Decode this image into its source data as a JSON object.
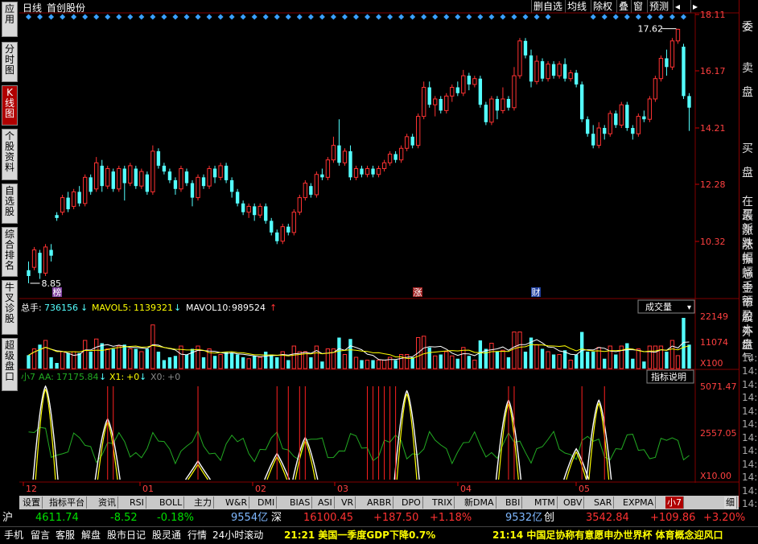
{
  "header": {
    "period": "日线",
    "stock_name": "首创股份",
    "buttons": [
      "删自选",
      "均线",
      "除权",
      "叠",
      "窗",
      "预测"
    ]
  },
  "left_tabs": [
    "应用",
    "分时图",
    "K线图",
    "个股资料",
    "自选股",
    "综合排名",
    "牛叉诊股",
    "超级盘口"
  ],
  "price_axis": [
    "18.11",
    "16.17",
    "14.21",
    "12.28",
    "10.32"
  ],
  "price_annotations": {
    "high": "17.62",
    "low": "8.85"
  },
  "event_markers": {
    "bang": "榜",
    "zhang": "涨",
    "cai": "财"
  },
  "volume_panel": {
    "total_label": "总手:",
    "total_value": "736156",
    "mavol5_label": "MAVOL5:",
    "mavol5_value": "1139321",
    "mavol10_label": "MAVOL10:",
    "mavol10_value": "989524",
    "dropdown": "成交量",
    "axis": [
      "22149",
      "11074",
      "X100"
    ]
  },
  "indicator_panel": {
    "name": "小7",
    "aa_label": "AA:",
    "aa_value": "17175.84",
    "x1_label": "X1:",
    "x1_value": "+0",
    "x0_label": "X0:",
    "x0_value": "+0",
    "help_button": "指标说明",
    "axis": [
      "5071.47",
      "2557.05",
      "X10.00"
    ]
  },
  "date_axis": [
    "12",
    "01",
    "02",
    "03",
    "04",
    "05"
  ],
  "right_panel": {
    "top": "委",
    "sell": "卖盘",
    "buy": "买盘",
    "labels": [
      "在买",
      "最新",
      "涨跌",
      "涨幅",
      "振幅",
      "总手",
      "金额",
      "市盈",
      "股本",
      "外盘"
    ],
    "times": [
      "燃气",
      "14:",
      "14:",
      "14:",
      "14:",
      "14:",
      "14:",
      "14:",
      "14:",
      "14:",
      "14:",
      "14:",
      "14:"
    ]
  },
  "bottom_tabs": [
    "设置",
    "指标平台",
    "资讯",
    "RSI",
    "BOLL",
    "主力",
    "W&R",
    "DMI",
    "BIAS",
    "ASI",
    "VR",
    "ARBR",
    "DPO",
    "TRIX",
    "新DMA",
    "BBI",
    "MTM",
    "OBV",
    "SAR",
    "EXPMA",
    "小7"
  ],
  "bottom_tab_extra": "细",
  "index_row": {
    "sh_label": "沪",
    "sh_value": "4611.74",
    "sh_change": "-8.52",
    "sh_pct": "-0.18%",
    "sh_amount": "9554亿",
    "sz_label": "深",
    "sz_value": "16100.45",
    "sz_change": "+187.50",
    "sz_pct": "+1.18%",
    "sz_amount": "9532亿",
    "cy_label": "创",
    "cy_value": "3542.84",
    "cy_change": "+109.86",
    "cy_pct": "+3.20%"
  },
  "footer": {
    "buttons": [
      "手机",
      "留言",
      "客服",
      "解盘",
      "股市日记",
      "股灵通",
      "行情",
      "24小时滚动"
    ],
    "news1": "21:21 美国一季度GDP下降0.7%",
    "news2": "21:14 中国足协称有意愿申办世界杯 体育概念迎风口"
  },
  "colors": {
    "up": "#ff3232",
    "down": "#54ffff",
    "diamond": "#3aa0ff",
    "grid": "#800000",
    "ma_white": "#ffffff",
    "ma_yellow": "#ffff00",
    "aa_green": "#22aa22"
  },
  "chart_data": {
    "type": "candlestick",
    "title": "",
    "date_ticks": [
      "12",
      "01",
      "02",
      "03",
      "04",
      "05"
    ],
    "ylim": [
      8.85,
      18.11
    ],
    "high_label": 17.62,
    "low_label": 8.85,
    "candles": [
      {
        "o": 9.3,
        "c": 9.1,
        "h": 9.6,
        "l": 8.85
      },
      {
        "o": 9.4,
        "c": 10.0,
        "h": 10.1,
        "l": 9.3
      },
      {
        "o": 9.9,
        "c": 9.2,
        "h": 10.0,
        "l": 9.0
      },
      {
        "o": 9.2,
        "c": 10.1,
        "h": 10.2,
        "l": 9.1
      },
      {
        "o": 10.0,
        "c": 9.8,
        "h": 10.2,
        "l": 9.6
      },
      {
        "o": 11.2,
        "c": 11.1,
        "h": 11.3,
        "l": 11.0
      },
      {
        "o": 11.3,
        "c": 11.8,
        "h": 11.9,
        "l": 11.2
      },
      {
        "o": 11.8,
        "c": 11.4,
        "h": 12.0,
        "l": 11.3
      },
      {
        "o": 11.5,
        "c": 12.0,
        "h": 12.1,
        "l": 11.4
      },
      {
        "o": 12.0,
        "c": 11.6,
        "h": 12.2,
        "l": 11.5
      },
      {
        "o": 11.6,
        "c": 12.5,
        "h": 12.6,
        "l": 11.5
      },
      {
        "o": 12.5,
        "c": 12.0,
        "h": 12.6,
        "l": 11.9
      },
      {
        "o": 12.1,
        "c": 13.0,
        "h": 13.2,
        "l": 12.0
      },
      {
        "o": 12.9,
        "c": 12.2,
        "h": 13.1,
        "l": 12.0
      },
      {
        "o": 12.2,
        "c": 12.8,
        "h": 12.9,
        "l": 12.1
      },
      {
        "o": 12.7,
        "c": 12.1,
        "h": 12.8,
        "l": 12.0
      },
      {
        "o": 12.1,
        "c": 12.8,
        "h": 12.9,
        "l": 12.0
      },
      {
        "o": 12.8,
        "c": 12.3,
        "h": 12.9,
        "l": 11.7
      },
      {
        "o": 12.3,
        "c": 12.9,
        "h": 13.0,
        "l": 12.2
      },
      {
        "o": 12.8,
        "c": 12.2,
        "h": 12.9,
        "l": 12.1
      },
      {
        "o": 12.2,
        "c": 12.7,
        "h": 12.8,
        "l": 12.1
      },
      {
        "o": 12.6,
        "c": 12.0,
        "h": 12.7,
        "l": 11.9
      },
      {
        "o": 12.0,
        "c": 13.4,
        "h": 13.6,
        "l": 11.9
      },
      {
        "o": 13.4,
        "c": 12.9,
        "h": 13.5,
        "l": 12.8
      },
      {
        "o": 12.9,
        "c": 12.7,
        "h": 13.0,
        "l": 12.6
      },
      {
        "o": 12.7,
        "c": 12.4,
        "h": 12.8,
        "l": 12.3
      },
      {
        "o": 12.4,
        "c": 12.1,
        "h": 12.5,
        "l": 11.9
      },
      {
        "o": 12.1,
        "c": 12.8,
        "h": 12.9,
        "l": 12.0
      },
      {
        "o": 12.7,
        "c": 12.3,
        "h": 12.8,
        "l": 12.2
      },
      {
        "o": 12.3,
        "c": 11.8,
        "h": 12.4,
        "l": 11.5
      },
      {
        "o": 11.8,
        "c": 12.5,
        "h": 12.6,
        "l": 11.7
      },
      {
        "o": 12.5,
        "c": 12.2,
        "h": 12.6,
        "l": 12.1
      },
      {
        "o": 12.2,
        "c": 12.8,
        "h": 12.9,
        "l": 12.1
      },
      {
        "o": 12.8,
        "c": 12.5,
        "h": 12.9,
        "l": 12.3
      },
      {
        "o": 12.5,
        "c": 12.9,
        "h": 13.0,
        "l": 12.4
      },
      {
        "o": 12.9,
        "c": 12.4,
        "h": 13.0,
        "l": 12.3
      },
      {
        "o": 12.4,
        "c": 12.0,
        "h": 12.5,
        "l": 11.8
      },
      {
        "o": 12.0,
        "c": 11.6,
        "h": 12.1,
        "l": 11.5
      },
      {
        "o": 11.6,
        "c": 11.3,
        "h": 11.7,
        "l": 11.2
      },
      {
        "o": 11.3,
        "c": 11.5,
        "h": 11.6,
        "l": 11.1
      },
      {
        "o": 11.5,
        "c": 11.2,
        "h": 11.6,
        "l": 11.0
      },
      {
        "o": 11.2,
        "c": 11.5,
        "h": 11.6,
        "l": 11.1
      },
      {
        "o": 11.5,
        "c": 11.0,
        "h": 11.6,
        "l": 10.9
      },
      {
        "o": 11.0,
        "c": 10.6,
        "h": 11.1,
        "l": 10.5
      },
      {
        "o": 10.6,
        "c": 10.3,
        "h": 10.7,
        "l": 10.2
      },
      {
        "o": 10.3,
        "c": 10.8,
        "h": 10.9,
        "l": 10.2
      },
      {
        "o": 10.8,
        "c": 10.6,
        "h": 10.9,
        "l": 10.5
      },
      {
        "o": 10.6,
        "c": 11.3,
        "h": 11.4,
        "l": 10.5
      },
      {
        "o": 11.3,
        "c": 11.8,
        "h": 11.9,
        "l": 11.2
      },
      {
        "o": 11.8,
        "c": 12.3,
        "h": 12.4,
        "l": 11.7
      },
      {
        "o": 12.2,
        "c": 11.9,
        "h": 12.3,
        "l": 11.8
      },
      {
        "o": 11.9,
        "c": 12.6,
        "h": 12.7,
        "l": 11.8
      },
      {
        "o": 12.6,
        "c": 12.5,
        "h": 12.8,
        "l": 12.4
      },
      {
        "o": 12.5,
        "c": 13.1,
        "h": 13.2,
        "l": 12.4
      },
      {
        "o": 13.1,
        "c": 13.6,
        "h": 13.9,
        "l": 13.0
      },
      {
        "o": 13.6,
        "c": 13.0,
        "h": 14.5,
        "l": 12.9
      },
      {
        "o": 13.0,
        "c": 13.4,
        "h": 13.5,
        "l": 12.9
      },
      {
        "o": 13.4,
        "c": 12.5,
        "h": 13.6,
        "l": 12.4
      },
      {
        "o": 12.5,
        "c": 12.8,
        "h": 12.9,
        "l": 12.4
      },
      {
        "o": 12.8,
        "c": 12.6,
        "h": 12.9,
        "l": 12.5
      },
      {
        "o": 12.6,
        "c": 12.8,
        "h": 12.9,
        "l": 12.5
      },
      {
        "o": 12.8,
        "c": 12.6,
        "h": 12.9,
        "l": 12.5
      },
      {
        "o": 12.6,
        "c": 12.8,
        "h": 12.9,
        "l": 12.5
      },
      {
        "o": 12.8,
        "c": 13.0,
        "h": 13.1,
        "l": 12.7
      },
      {
        "o": 13.0,
        "c": 13.3,
        "h": 13.4,
        "l": 12.9
      },
      {
        "o": 13.3,
        "c": 13.1,
        "h": 13.4,
        "l": 13.0
      },
      {
        "o": 13.1,
        "c": 13.5,
        "h": 13.6,
        "l": 13.0
      },
      {
        "o": 13.5,
        "c": 13.9,
        "h": 14.0,
        "l": 13.4
      },
      {
        "o": 13.9,
        "c": 13.6,
        "h": 14.0,
        "l": 13.5
      },
      {
        "o": 13.6,
        "c": 14.6,
        "h": 14.7,
        "l": 13.5
      },
      {
        "o": 14.6,
        "c": 15.6,
        "h": 15.8,
        "l": 14.5
      },
      {
        "o": 15.6,
        "c": 15.0,
        "h": 15.8,
        "l": 14.9
      },
      {
        "o": 15.0,
        "c": 15.2,
        "h": 15.3,
        "l": 14.6
      },
      {
        "o": 15.2,
        "c": 14.8,
        "h": 15.3,
        "l": 14.7
      },
      {
        "o": 14.8,
        "c": 15.3,
        "h": 15.4,
        "l": 14.7
      },
      {
        "o": 15.3,
        "c": 15.6,
        "h": 15.7,
        "l": 15.1
      },
      {
        "o": 15.6,
        "c": 15.4,
        "h": 15.8,
        "l": 15.3
      },
      {
        "o": 15.4,
        "c": 16.0,
        "h": 16.2,
        "l": 15.3
      },
      {
        "o": 16.0,
        "c": 15.7,
        "h": 16.1,
        "l": 15.5
      },
      {
        "o": 15.7,
        "c": 15.9,
        "h": 16.0,
        "l": 15.6
      },
      {
        "o": 15.9,
        "c": 15.0,
        "h": 16.0,
        "l": 14.9
      },
      {
        "o": 15.0,
        "c": 14.4,
        "h": 15.1,
        "l": 14.3
      },
      {
        "o": 14.4,
        "c": 15.2,
        "h": 15.3,
        "l": 14.3
      },
      {
        "o": 15.2,
        "c": 14.8,
        "h": 15.3,
        "l": 14.5
      },
      {
        "o": 14.8,
        "c": 15.2,
        "h": 15.6,
        "l": 14.7
      },
      {
        "o": 15.2,
        "c": 14.9,
        "h": 15.3,
        "l": 14.8
      },
      {
        "o": 14.9,
        "c": 16.0,
        "h": 16.3,
        "l": 14.8
      },
      {
        "o": 16.0,
        "c": 17.2,
        "h": 17.3,
        "l": 15.9
      },
      {
        "o": 17.2,
        "c": 16.7,
        "h": 17.3,
        "l": 16.6
      },
      {
        "o": 16.7,
        "c": 15.8,
        "h": 16.9,
        "l": 15.6
      },
      {
        "o": 15.8,
        "c": 16.5,
        "h": 16.7,
        "l": 15.7
      },
      {
        "o": 16.5,
        "c": 15.9,
        "h": 16.6,
        "l": 15.8
      },
      {
        "o": 15.9,
        "c": 16.4,
        "h": 16.5,
        "l": 15.8
      },
      {
        "o": 16.4,
        "c": 16.0,
        "h": 16.5,
        "l": 15.9
      },
      {
        "o": 16.0,
        "c": 16.4,
        "h": 16.5,
        "l": 15.9
      },
      {
        "o": 16.4,
        "c": 15.9,
        "h": 16.6,
        "l": 15.8
      },
      {
        "o": 15.9,
        "c": 16.1,
        "h": 16.2,
        "l": 15.8
      },
      {
        "o": 16.1,
        "c": 15.7,
        "h": 16.2,
        "l": 15.6
      },
      {
        "o": 15.7,
        "c": 14.5,
        "h": 15.8,
        "l": 14.4
      },
      {
        "o": 14.5,
        "c": 14.0,
        "h": 14.6,
        "l": 13.9
      },
      {
        "o": 14.0,
        "c": 13.6,
        "h": 14.3,
        "l": 13.5
      },
      {
        "o": 13.6,
        "c": 14.2,
        "h": 14.4,
        "l": 13.5
      },
      {
        "o": 14.2,
        "c": 14.0,
        "h": 14.3,
        "l": 13.8
      },
      {
        "o": 14.0,
        "c": 14.7,
        "h": 14.8,
        "l": 13.9
      },
      {
        "o": 14.7,
        "c": 14.3,
        "h": 14.8,
        "l": 14.2
      },
      {
        "o": 14.3,
        "c": 15.0,
        "h": 15.1,
        "l": 14.2
      },
      {
        "o": 15.0,
        "c": 14.2,
        "h": 15.1,
        "l": 14.1
      },
      {
        "o": 14.2,
        "c": 14.0,
        "h": 14.3,
        "l": 13.8
      },
      {
        "o": 14.0,
        "c": 14.6,
        "h": 14.7,
        "l": 13.9
      },
      {
        "o": 14.6,
        "c": 14.5,
        "h": 14.8,
        "l": 14.4
      },
      {
        "o": 14.5,
        "c": 15.2,
        "h": 15.3,
        "l": 14.4
      },
      {
        "o": 15.2,
        "c": 15.9,
        "h": 16.0,
        "l": 15.1
      },
      {
        "o": 15.9,
        "c": 16.6,
        "h": 16.7,
        "l": 15.8
      },
      {
        "o": 16.6,
        "c": 16.3,
        "h": 16.9,
        "l": 16.0
      },
      {
        "o": 16.3,
        "c": 17.2,
        "h": 17.3,
        "l": 16.2
      },
      {
        "o": 17.2,
        "c": 17.6,
        "h": 17.62,
        "l": 17.1
      },
      {
        "o": 17.0,
        "c": 15.3,
        "h": 17.1,
        "l": 15.2
      },
      {
        "o": 15.3,
        "c": 14.9,
        "h": 15.4,
        "l": 14.1
      }
    ]
  }
}
